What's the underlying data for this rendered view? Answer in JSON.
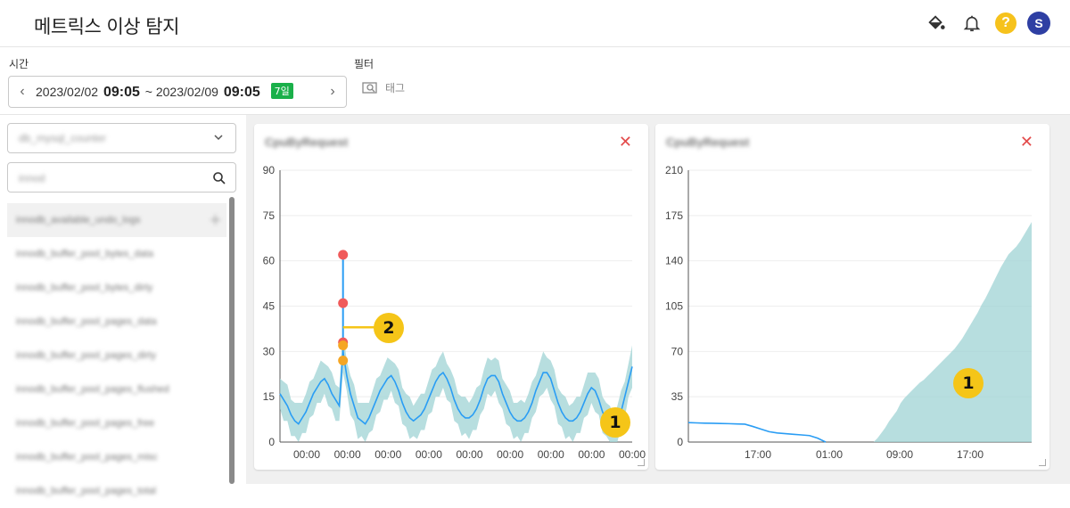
{
  "app_title": "메트릭스 이상 탐지",
  "header_icons": {
    "help_label": "?",
    "user_initial": "S"
  },
  "filters": {
    "time_label": "시간",
    "filter_label": "필터",
    "time_start_date": "2023/02/02",
    "time_start_hm": "09:05",
    "time_sep": "~",
    "time_end_date": "2023/02/09",
    "time_end_hm": "09:05",
    "range_badge": "7일",
    "tag_button": "태그"
  },
  "sidebar": {
    "database_select": "db_mysql_counter",
    "search_value": "innod",
    "metrics": [
      "innodb_available_undo_logs",
      "innodb_buffer_pool_bytes_data",
      "innodb_buffer_pool_bytes_dirty",
      "innodb_buffer_pool_pages_data",
      "innodb_buffer_pool_pages_dirty",
      "innodb_buffer_pool_pages_flushed",
      "innodb_buffer_pool_pages_free",
      "innodb_buffer_pool_pages_misc",
      "innodb_buffer_pool_pages_total"
    ]
  },
  "colors": {
    "line": "#2a9df4",
    "band": "#9fd3d4",
    "anomaly_red": "#f05a5a",
    "anomaly_orange": "#f5a623",
    "marker": "#f5c518"
  },
  "markers": {
    "m1": "1",
    "m2": "2"
  },
  "chart_data": [
    {
      "type": "line",
      "title": "CpuByRequest",
      "y_ticks": [
        "0",
        "15",
        "30",
        "45",
        "60",
        "75",
        "90"
      ],
      "ylim": [
        0,
        90
      ],
      "x_ticks": [
        "00:00",
        "00:00",
        "00:00",
        "00:00",
        "00:00",
        "00:00",
        "00:00",
        "00:00",
        "00:00"
      ],
      "series": [
        {
          "values": [
            16,
            14,
            12,
            9,
            7,
            6,
            8,
            10,
            13,
            16,
            18,
            20,
            21,
            19,
            16,
            14,
            12,
            30,
            22,
            16,
            12,
            8,
            7,
            6,
            8,
            11,
            14,
            17,
            19,
            21,
            22,
            20,
            17,
            13,
            10,
            8,
            7,
            8,
            9,
            11,
            14,
            17,
            20,
            22,
            23,
            21,
            18,
            14,
            11,
            9,
            8,
            8,
            9,
            11,
            14,
            18,
            21,
            22,
            22,
            20,
            16,
            13,
            10,
            8,
            7,
            7,
            8,
            10,
            13,
            17,
            20,
            23,
            23,
            21,
            17,
            13,
            10,
            8,
            7,
            7,
            8,
            10,
            13,
            16,
            18,
            17,
            14,
            10,
            7,
            5,
            4,
            6,
            10,
            15,
            20,
            25
          ]
        }
      ],
      "band_width": 5,
      "anomalies_red": [
        62,
        46,
        33
      ],
      "anomalies_orange": [
        32,
        27
      ]
    },
    {
      "type": "area",
      "title": "CpuByRequest",
      "y_ticks": [
        "0",
        "35",
        "70",
        "105",
        "140",
        "175",
        "210"
      ],
      "ylim": [
        0,
        210
      ],
      "x_ticks": [
        "17:00",
        "01:00",
        "09:00",
        "17:00"
      ],
      "series": [
        {
          "values": [
            15,
            14.8,
            14.6,
            14.5,
            14.3,
            14.2,
            14.0,
            13.8,
            12.0,
            10.0,
            8.0,
            7.0,
            6.5,
            6.0,
            5.5,
            5.0,
            3.0,
            0,
            0,
            0,
            0,
            0,
            0,
            0,
            0,
            0,
            0,
            0,
            0,
            0,
            0,
            0,
            0,
            0,
            0,
            0,
            0,
            0,
            0,
            0,
            0,
            0,
            0,
            0,
            0,
            0,
            0,
            0,
            0,
            0,
            0,
            0,
            0,
            0,
            0,
            0,
            0,
            0,
            0,
            0,
            0,
            0,
            0,
            0,
            0,
            0,
            0,
            0,
            0,
            0,
            0,
            0,
            0,
            0,
            0,
            0,
            0,
            0,
            0,
            0,
            0,
            0,
            0,
            0,
            0,
            0,
            0,
            0,
            0
          ]
        }
      ],
      "area_values": [
        0,
        0,
        0,
        0,
        0,
        0,
        0,
        0,
        0,
        0,
        0,
        0,
        0,
        0,
        0,
        0,
        0,
        3,
        7,
        11,
        16,
        20,
        24,
        30,
        34,
        37,
        40,
        43,
        46,
        48,
        51,
        54,
        57,
        60,
        63,
        66,
        69,
        72,
        76,
        80,
        85,
        90,
        95,
        100,
        106,
        111,
        117,
        123,
        129,
        135,
        140,
        145,
        148,
        151,
        155,
        160,
        165,
        170
      ]
    }
  ]
}
